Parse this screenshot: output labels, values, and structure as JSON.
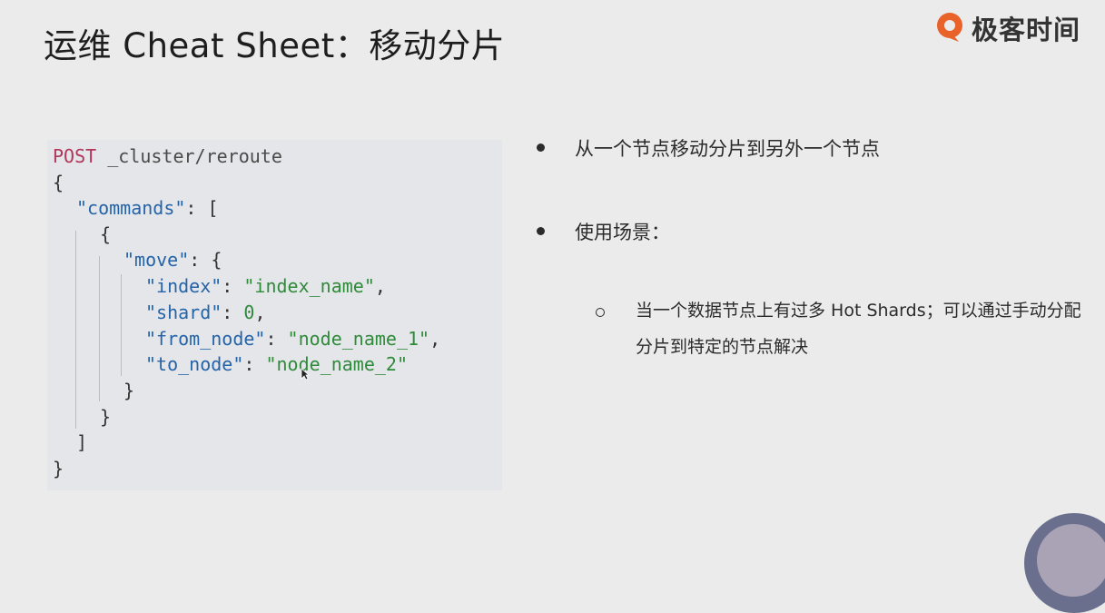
{
  "slide": {
    "title": "运维 Cheat Sheet：移动分片",
    "brand": "极客时间",
    "brand_color": "#e8622a"
  },
  "code": {
    "method": "POST",
    "path": "_cluster/reroute",
    "lines": {
      "open_brace": "{",
      "commands_key": "\"commands\"",
      "commands_tail": ": [",
      "inner_open": "{",
      "move_key": "\"move\"",
      "move_tail": ": {",
      "index_key": "\"index\"",
      "index_value": "\"index_name\"",
      "shard_key": "\"shard\"",
      "shard_value": "0",
      "from_key": "\"from_node\"",
      "from_value": "\"node_name_1\"",
      "to_key": "\"to_node\"",
      "to_value": "\"node_name_2\"",
      "move_close": "}",
      "inner_close": "}",
      "array_close": "]",
      "close_brace": "}"
    },
    "colors": {
      "method": "#b2355a",
      "key": "#2563a8",
      "string": "#2f8a3a"
    }
  },
  "bullets": {
    "item1": "从一个节点移动分片到另外一个节点",
    "item2": "使用场景：",
    "sub1": "当一个数据节点上有过多 Hot Shards；可以通过手动分配分片到特定的节点解决"
  }
}
